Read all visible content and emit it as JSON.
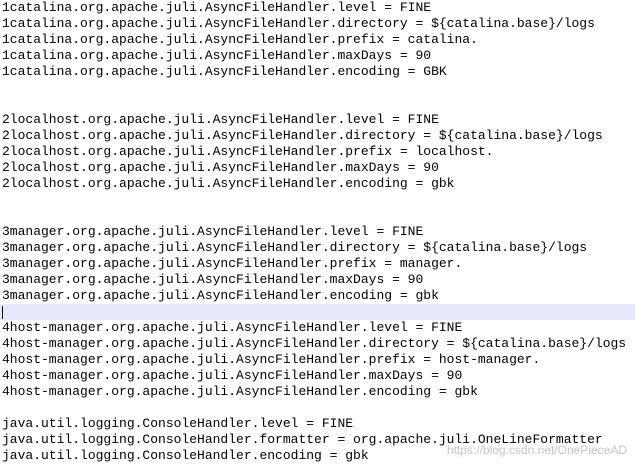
{
  "editor": {
    "lines": [
      "1catalina.org.apache.juli.AsyncFileHandler.level = FINE",
      "1catalina.org.apache.juli.AsyncFileHandler.directory = ${catalina.base}/logs",
      "1catalina.org.apache.juli.AsyncFileHandler.prefix = catalina.",
      "1catalina.org.apache.juli.AsyncFileHandler.maxDays = 90",
      "1catalina.org.apache.juli.AsyncFileHandler.encoding = GBK",
      "",
      "",
      "2localhost.org.apache.juli.AsyncFileHandler.level = FINE",
      "2localhost.org.apache.juli.AsyncFileHandler.directory = ${catalina.base}/logs",
      "2localhost.org.apache.juli.AsyncFileHandler.prefix = localhost.",
      "2localhost.org.apache.juli.AsyncFileHandler.maxDays = 90",
      "2localhost.org.apache.juli.AsyncFileHandler.encoding = gbk",
      "",
      "",
      "3manager.org.apache.juli.AsyncFileHandler.level = FINE",
      "3manager.org.apache.juli.AsyncFileHandler.directory = ${catalina.base}/logs",
      "3manager.org.apache.juli.AsyncFileHandler.prefix = manager.",
      "3manager.org.apache.juli.AsyncFileHandler.maxDays = 90",
      "3manager.org.apache.juli.AsyncFileHandler.encoding = gbk",
      "",
      "4host-manager.org.apache.juli.AsyncFileHandler.level = FINE",
      "4host-manager.org.apache.juli.AsyncFileHandler.directory = ${catalina.base}/logs",
      "4host-manager.org.apache.juli.AsyncFileHandler.prefix = host-manager.",
      "4host-manager.org.apache.juli.AsyncFileHandler.maxDays = 90",
      "4host-manager.org.apache.juli.AsyncFileHandler.encoding = gbk",
      "",
      "java.util.logging.ConsoleHandler.level = FINE",
      "java.util.logging.ConsoleHandler.formatter = org.apache.juli.OneLineFormatter",
      "java.util.logging.ConsoleHandler.encoding = gbk"
    ],
    "current_line_index": 19,
    "current_line_color": "#e8e8ff",
    "text_color": "#000000",
    "background_color": "#ffffff"
  },
  "watermark": "https://blog.csdn.net/OnePieceAD"
}
